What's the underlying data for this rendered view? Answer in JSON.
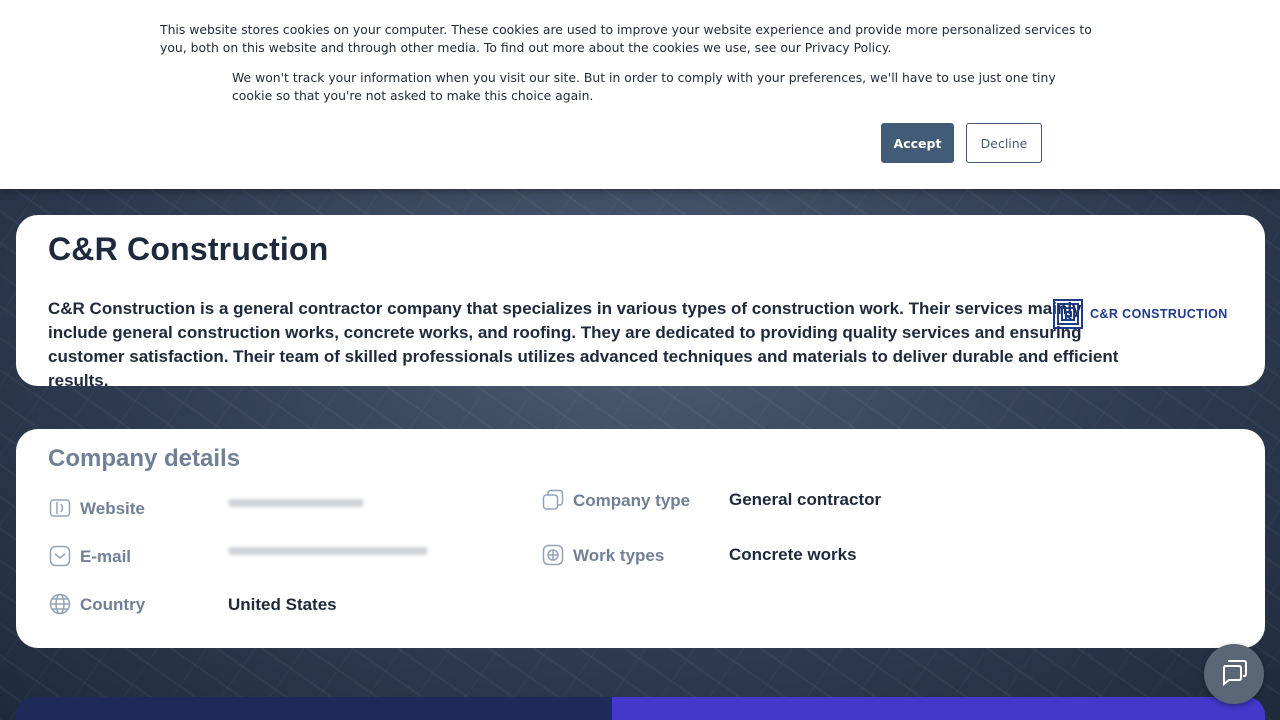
{
  "cookie_banner": {
    "text_main": "This website stores cookies on your computer. These cookies are used to improve your website experience and provide more personalized services to you, both on this website and through other media. To find out more about the cookies we use, see our Privacy Policy.",
    "text_secondary": "We won't track your information when you visit our site. But in order to comply with your preferences, we'll have to use just one tiny cookie so that you're not asked to make this choice again.",
    "accept_label": "Accept",
    "decline_label": "Decline"
  },
  "company": {
    "name": "C&R Construction",
    "description": "C&R Construction is a general contractor company that specializes in various types of construction work. Their services mainly include general construction works, concrete works, and roofing. They are dedicated to providing quality services and ensuring customer satisfaction. Their team of skilled professionals utilizes advanced techniques and materials to deliver durable and efficient results.",
    "logo_text": "C&R CONSTRUCTION"
  },
  "details": {
    "section_title": "Company details",
    "website_label": "Website",
    "email_label": "E-mail",
    "country_label": "Country",
    "country_value": "United States",
    "company_type_label": "Company type",
    "company_type_value": "General contractor",
    "work_types_label": "Work types",
    "work_types_value": "Concrete works"
  },
  "icons": {
    "website": "website-icon",
    "email": "envelope-icon",
    "country": "globe-icon",
    "company_type": "squares-icon",
    "work_types": "grid-icon",
    "chat": "chat-icon"
  },
  "colors": {
    "accent": "#425b76",
    "title": "#1e293b",
    "label": "#718096",
    "logo": "#1e3a8a",
    "bottom_left": "#1e2a5a",
    "bottom_right": "#4338ca"
  }
}
